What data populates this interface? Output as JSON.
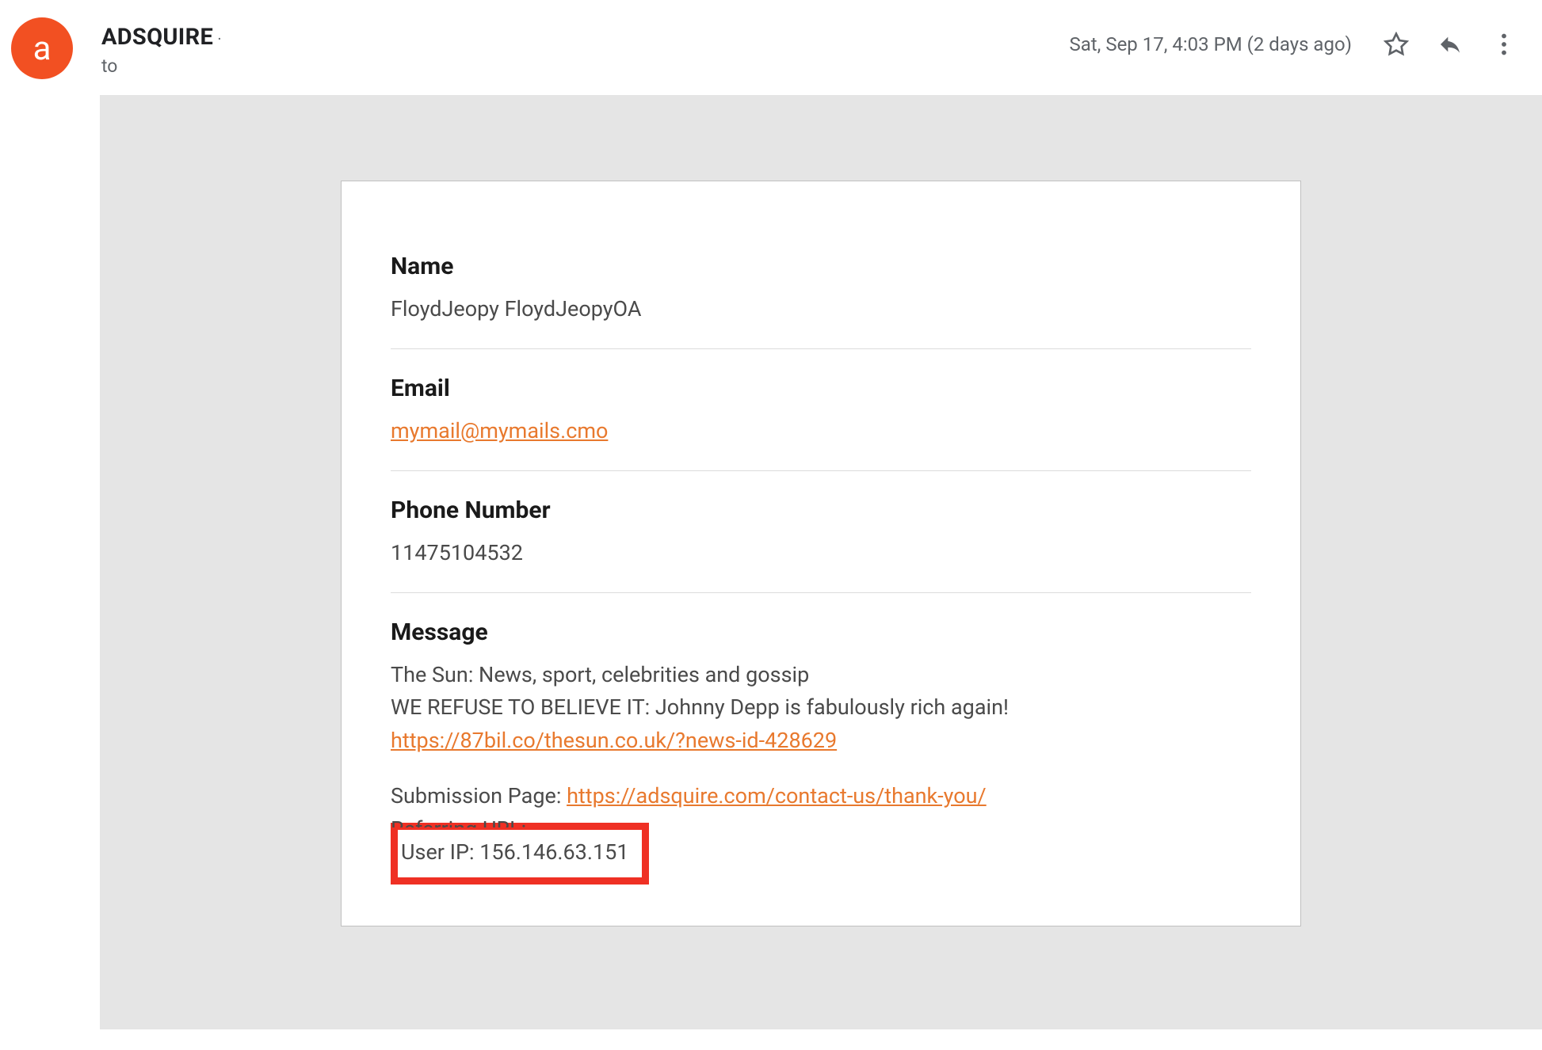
{
  "header": {
    "avatar_letter": "a",
    "sender_name": "ADSQUIRE",
    "recipient_label": "to",
    "date_text": "Sat, Sep 17, 4:03 PM (2 days ago)"
  },
  "body": {
    "name_label": "Name",
    "name_value": "FloydJeopy FloydJeopyOA",
    "email_label": "Email",
    "email_value": "mymail@mymails.cmo",
    "phone_label": "Phone Number",
    "phone_value": "11475104532",
    "message_label": "Message",
    "msg_line1": "The Sun: News, sport, celebrities and gossip",
    "msg_line2": "WE REFUSE TO BELIEVE IT: Johnny Depp is fabulously rich again!",
    "msg_link1": "https://87bil.co/thesun.co.uk/?news-id-428629",
    "submission_label": "Submission Page: ",
    "submission_link": "https://adsquire.com/contact-us/thank-you/",
    "referring_label": "Referring URL:",
    "user_ip_line": "User IP: 156.146.63.151"
  }
}
